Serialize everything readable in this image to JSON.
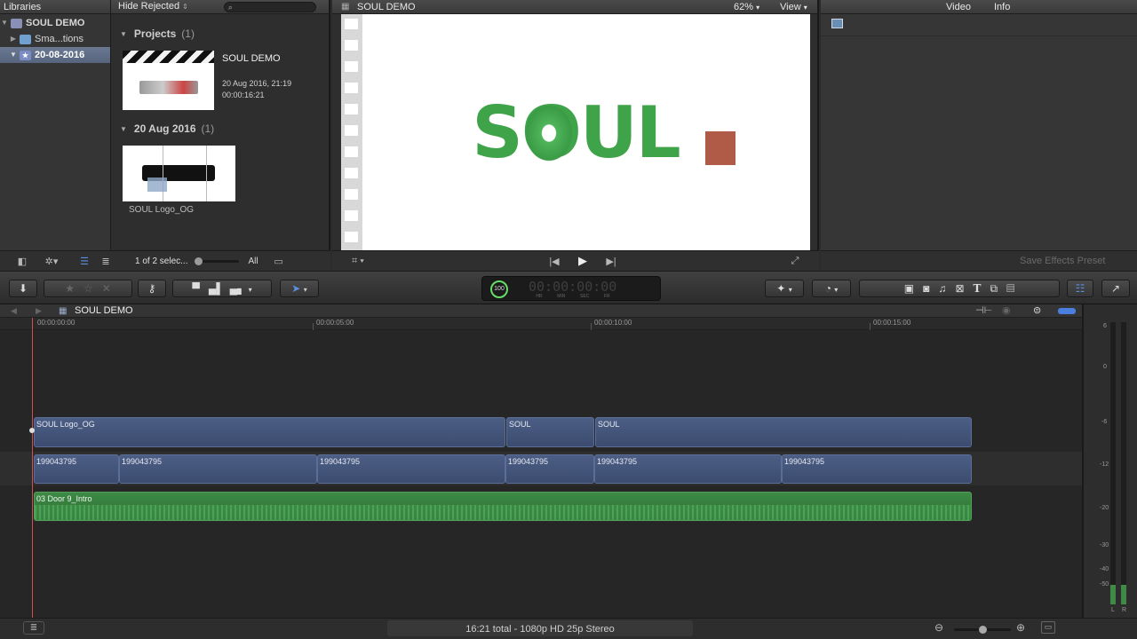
{
  "libraries": {
    "header": "Libraries",
    "items": [
      {
        "label": "SOUL DEMO"
      },
      {
        "label": "Sma...tions"
      },
      {
        "label": "20-08-2016"
      }
    ]
  },
  "browser": {
    "filter_label": "Hide Rejected",
    "projects_header": "Projects",
    "projects_count": "(1)",
    "project": {
      "title": "SOUL DEMO",
      "date": "20 Aug 2016, 21:19",
      "duration": "00:00:16:21"
    },
    "event_header": "20 Aug 2016",
    "event_count": "(1)",
    "clip_name": "SOUL Logo_OG",
    "selection_status": "1 of 2 selec...",
    "duration_filter": "All"
  },
  "viewer": {
    "title": "SOUL DEMO",
    "zoom": "62%",
    "view_label": "View",
    "logo_text": "SOUL"
  },
  "inspector": {
    "tab_video": "Video",
    "tab_info": "Info",
    "save_preset": "Save Effects Preset"
  },
  "timecode": {
    "display": "00:00:00:00",
    "percent": "100",
    "labels": [
      "HR",
      "MIN",
      "SEC",
      "FR"
    ]
  },
  "timeline": {
    "project_name": "SOUL DEMO",
    "ruler": [
      "00:00:00:00",
      "00:00:05:00",
      "00:00:10:00",
      "00:00:15:00"
    ],
    "title_clips": [
      "SOUL Logo_OG",
      "SOUL",
      "SOUL"
    ],
    "video_clips": [
      "199043795",
      "199043795",
      "199043795",
      "199043795",
      "199043795",
      "199043795"
    ],
    "audio_clip": "03 Door 9_Intro"
  },
  "meters": {
    "scale": [
      "6",
      "0",
      "-6",
      "-12",
      "-20",
      "-30",
      "-40",
      "-50"
    ],
    "channels": [
      "L",
      "R"
    ]
  },
  "status": {
    "summary": "16:21 total - 1080p HD 25p Stereo"
  }
}
